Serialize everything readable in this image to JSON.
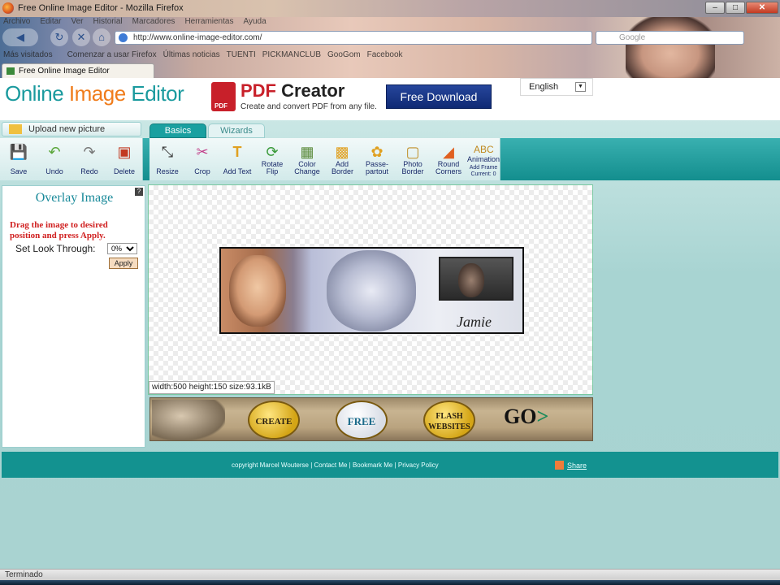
{
  "window": {
    "title": "Free Online Image Editor - Mozilla Firefox"
  },
  "menu": [
    "Archivo",
    "Editar",
    "Ver",
    "Historial",
    "Marcadores",
    "Herramientas",
    "Ayuda"
  ],
  "nav": {
    "url": "http://www.online-image-editor.com/",
    "search_placeholder": "Google"
  },
  "bookmarks": [
    "Más visitados",
    "Comenzar a usar Firefox",
    "Últimas noticias",
    "TUENTI",
    "PICKMANCLUB",
    "GooGom",
    "Facebook"
  ],
  "tab": {
    "label": "Free Online Image Editor"
  },
  "site": {
    "logo_a": "Online ",
    "logo_b": "Image",
    "logo_c": " Editor",
    "ad_title_a": "PDF",
    "ad_title_b": " Creator",
    "ad_sub": "Create and convert PDF from any file.",
    "ad_button": "Free Download",
    "language": "English"
  },
  "nav2": {
    "upload": "Upload new picture",
    "tab_basics": "Basics",
    "tab_wizards": "Wizards"
  },
  "tools_left": [
    {
      "label": "Save",
      "icon": "floppy-icon"
    },
    {
      "label": "Undo",
      "icon": "undo-arrow-icon"
    },
    {
      "label": "Redo",
      "icon": "redo-arrow-icon"
    },
    {
      "label": "Delete",
      "icon": "delete-icon"
    }
  ],
  "tools_main": [
    {
      "label": "Resize",
      "icon": "resize-icon"
    },
    {
      "label": "Crop",
      "icon": "scissors-icon"
    },
    {
      "label": "Add Text",
      "icon": "text-icon"
    },
    {
      "label": "Rotate Flip",
      "icon": "rotate-icon"
    },
    {
      "label": "Color Change",
      "icon": "color-icon"
    },
    {
      "label": "Add Border",
      "icon": "border-icon"
    },
    {
      "label": "Passe-partout",
      "icon": "passepartout-icon"
    },
    {
      "label": "Photo Border",
      "icon": "photo-border-icon"
    },
    {
      "label": "Round Corners",
      "icon": "round-corners-icon"
    },
    {
      "label": "Animation",
      "icon": "animation-icon",
      "sub1": "Add Frame",
      "sub2": "Current: 0"
    }
  ],
  "panel": {
    "title": "Overlay Image",
    "instruction": "Drag the image to desired position and press Apply.",
    "look_label": "Set Look Through:",
    "look_value": "0%",
    "apply": "Apply"
  },
  "image": {
    "signature": "Jamie",
    "info": "width:500 height:150 size:93.1kB"
  },
  "banner": {
    "create": "CREATE",
    "free": "FREE",
    "flash": "FLASH WEBSITES",
    "go": "GO"
  },
  "footer": {
    "copyright": "copyright Marcel Wouterse",
    "contact": "Contact Me",
    "bookmark": "Bookmark Me",
    "privacy": "Privacy Policy",
    "share": "Share"
  },
  "status": {
    "text": "Terminado"
  }
}
